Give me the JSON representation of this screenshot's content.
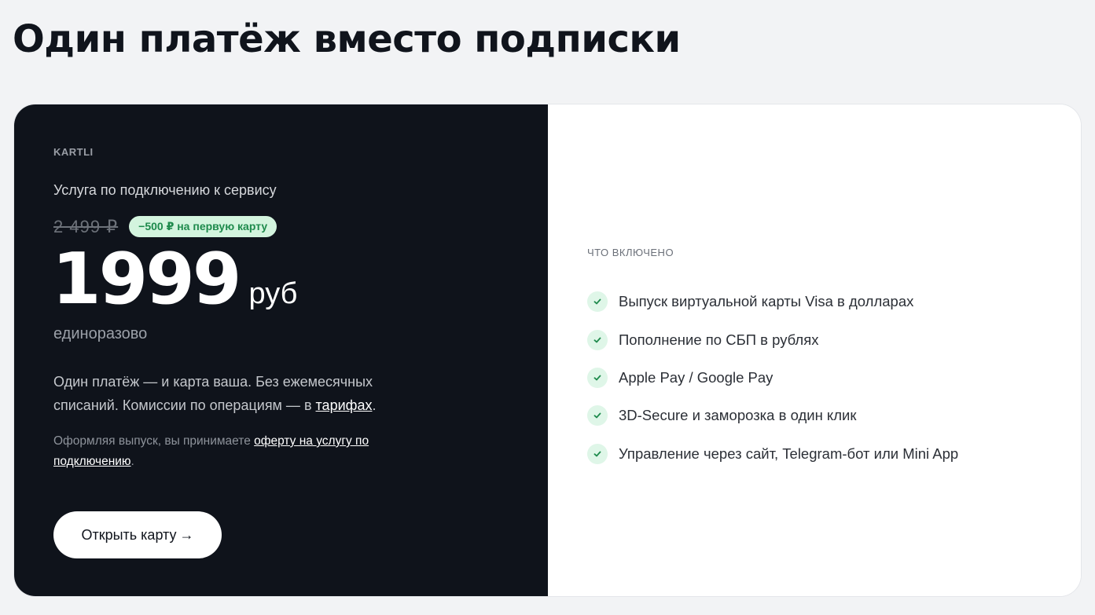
{
  "page": {
    "title": "Один платёж вместо подписки"
  },
  "offer_card": {
    "brand": "KARTLI",
    "service_label": "Услуга по подключению к сервису",
    "old_price": "2 499 ₽",
    "discount_badge": "−500 ₽ на первую карту",
    "price_value": "1999",
    "price_unit": "руб",
    "payment_type": "единоразово",
    "description_text": "Один платёж — и карта ваша. Без ежемесячных списаний. Комиссии по операциям — в ",
    "tariffs_link": "тарифах",
    "description_end": ".",
    "offer_text": "Оформляя выпуск, вы принимаете ",
    "offer_link": "оферту на услугу по подключению",
    "offer_end": ".",
    "button_label": "Открыть карту",
    "button_arrow": "→"
  },
  "included": {
    "title": "ЧТО ВКЛЮЧЕНО",
    "items": [
      {
        "label": "Выпуск виртуальной карты Visa в долларах",
        "icon": "check-icon"
      },
      {
        "label": "Пополнение по СБП в рублях",
        "icon": "check-icon"
      },
      {
        "label": "Apple Pay / Google Pay",
        "icon": "check-icon"
      },
      {
        "label": "3D-Secure и заморозка в один клик",
        "icon": "check-icon"
      },
      {
        "label": "Управление через сайт, Telegram-бот или Mini App",
        "icon": "check-icon"
      }
    ]
  },
  "colors": {
    "dark_panel": "#0f131b",
    "accent_green": "#1e8a4c",
    "badge_bg": "#d3f4de",
    "check_bg": "#dff6e8",
    "page_bg": "#f2f3f5"
  }
}
